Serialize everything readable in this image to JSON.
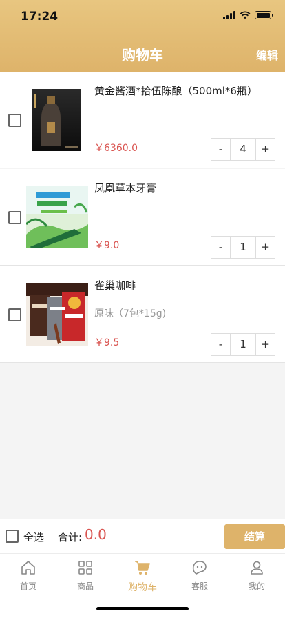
{
  "status_bar": {
    "time": "17:24"
  },
  "header": {
    "title": "购物车",
    "edit_label": "编辑"
  },
  "cart_items": [
    {
      "name": "黄金酱酒*拾伍陈酿（500ml*6瓶）",
      "spec": "",
      "price": "￥6360.0",
      "quantity": "4",
      "minus": "-",
      "plus": "+"
    },
    {
      "name": "凤凰草本牙膏",
      "spec": "",
      "price": "￥9.0",
      "quantity": "1",
      "minus": "-",
      "plus": "+"
    },
    {
      "name": "雀巢咖啡",
      "spec": "原味（7包*15g)",
      "price": "￥9.5",
      "quantity": "1",
      "minus": "-",
      "plus": "+"
    }
  ],
  "footer": {
    "select_all_label": "全选",
    "total_label": "合计:",
    "total_value": "0.0",
    "checkout_label": "结算"
  },
  "tabbar": {
    "tabs": [
      {
        "label": "首页",
        "icon": "home-icon"
      },
      {
        "label": "商品",
        "icon": "grid-icon"
      },
      {
        "label": "购物车",
        "icon": "cart-icon",
        "active": true
      },
      {
        "label": "客服",
        "icon": "chat-icon"
      },
      {
        "label": "我的",
        "icon": "user-icon"
      }
    ]
  },
  "colors": {
    "accent": "#deb36a",
    "price": "#d9534f"
  }
}
